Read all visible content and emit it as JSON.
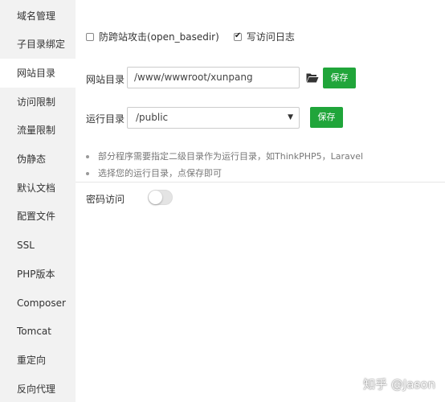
{
  "sidebar": {
    "items": [
      {
        "label": "域名管理"
      },
      {
        "label": "子目录绑定"
      },
      {
        "label": "网站目录"
      },
      {
        "label": "访问限制"
      },
      {
        "label": "流量限制"
      },
      {
        "label": "伪静态"
      },
      {
        "label": "默认文档"
      },
      {
        "label": "配置文件"
      },
      {
        "label": "SSL"
      },
      {
        "label": "PHP版本"
      },
      {
        "label": "Composer"
      },
      {
        "label": "Tomcat"
      },
      {
        "label": "重定向"
      },
      {
        "label": "反向代理"
      }
    ],
    "active": "网站目录"
  },
  "options": {
    "anti_xss_label": "防跨站攻击(open_basedir)",
    "anti_xss_checked": false,
    "access_log_label": "写访问日志",
    "access_log_checked": true
  },
  "site_dir": {
    "label": "网站目录",
    "value": "/www/wwwroot/xunpang",
    "folder_icon": "folder-open-icon",
    "save_label": "保存"
  },
  "run_dir": {
    "label": "运行目录",
    "selected": "/public",
    "save_label": "保存"
  },
  "tips": [
    "部分程序需要指定二级目录作为运行目录，如ThinkPHP5，Laravel",
    "选择您的运行目录，点保存即可"
  ],
  "password_access": {
    "label": "密码访问",
    "enabled": false
  },
  "watermark": "知乎 @Jason",
  "colors": {
    "accent": "#20a53a",
    "sidebar_bg": "#f2f2f2"
  }
}
